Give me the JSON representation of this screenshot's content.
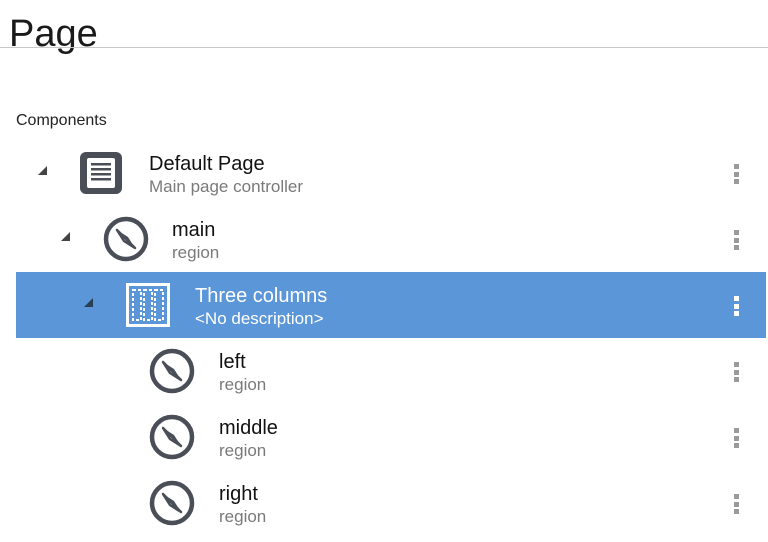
{
  "page": {
    "title": "Page",
    "components_label": "Components"
  },
  "tree": {
    "nodes": [
      {
        "label": "Default Page",
        "description": "Main page controller",
        "icon": "page-document-icon",
        "expanded": true
      },
      {
        "label": "main",
        "description": "region",
        "icon": "compass-icon",
        "expanded": true
      },
      {
        "label": "Three columns",
        "description": "<No description>",
        "icon": "three-columns-icon",
        "expanded": true,
        "selected": true
      },
      {
        "label": "left",
        "description": "region",
        "icon": "compass-icon"
      },
      {
        "label": "middle",
        "description": "region",
        "icon": "compass-icon"
      },
      {
        "label": "right",
        "description": "region",
        "icon": "compass-icon"
      }
    ]
  },
  "colors": {
    "selected_row": "#5a96d8",
    "icon_dark": "#4a4e57",
    "menu_dots": "#9a9a9a"
  }
}
